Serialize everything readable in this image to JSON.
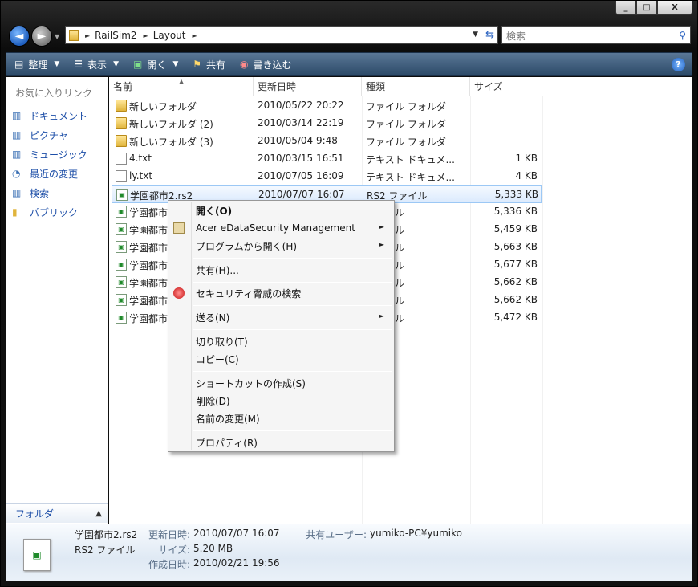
{
  "window": {
    "min": "_",
    "max": "□",
    "close": "X"
  },
  "address": {
    "segments": [
      "RailSim2",
      "Layout"
    ]
  },
  "search": {
    "placeholder": "検索"
  },
  "toolbar": {
    "organize": "整理",
    "view": "表示",
    "open": "開く",
    "share": "共有",
    "burn": "書き込む"
  },
  "left_pane": {
    "heading": "お気に入りリンク",
    "items": [
      "ドキュメント",
      "ピクチャ",
      "ミュージック",
      "最近の変更",
      "検索",
      "パブリック"
    ],
    "folders": "フォルダ"
  },
  "columns": {
    "name": "名前",
    "date": "更新日時",
    "type": "種類",
    "size": "サイズ"
  },
  "files": [
    {
      "name": "新しいフォルダ",
      "date": "2010/05/22 20:22",
      "type": "ファイル フォルダ",
      "size": "",
      "kind": "folder"
    },
    {
      "name": "新しいフォルダ (2)",
      "date": "2010/03/14 22:19",
      "type": "ファイル フォルダ",
      "size": "",
      "kind": "folder"
    },
    {
      "name": "新しいフォルダ (3)",
      "date": "2010/05/04 9:48",
      "type": "ファイル フォルダ",
      "size": "",
      "kind": "folder"
    },
    {
      "name": "4.txt",
      "date": "2010/03/15 16:51",
      "type": "テキスト ドキュメ...",
      "size": "1 KB",
      "kind": "txt"
    },
    {
      "name": "ly.txt",
      "date": "2010/07/05 16:09",
      "type": "テキスト ドキュメ...",
      "size": "4 KB",
      "kind": "txt"
    },
    {
      "name": "学園都市2.rs2",
      "date": "2010/07/07 16:07",
      "type": "RS2 ファイル",
      "size": "5,333 KB",
      "kind": "rs2"
    },
    {
      "name": "学園都市",
      "date": "",
      "type": "ファイル",
      "size": "5,336 KB",
      "kind": "rs2"
    },
    {
      "name": "学園都市",
      "date": "",
      "type": "ファイル",
      "size": "5,459 KB",
      "kind": "rs2"
    },
    {
      "name": "学園都市",
      "date": "",
      "type": "ファイル",
      "size": "5,663 KB",
      "kind": "rs2"
    },
    {
      "name": "学園都市",
      "date": "",
      "type": "ファイル",
      "size": "5,677 KB",
      "kind": "rs2"
    },
    {
      "name": "学園都市",
      "date": "",
      "type": "ファイル",
      "size": "5,662 KB",
      "kind": "rs2"
    },
    {
      "name": "学園都市",
      "date": "",
      "type": "ファイル",
      "size": "5,662 KB",
      "kind": "rs2"
    },
    {
      "name": "学園都市",
      "date": "",
      "type": "ファイル",
      "size": "5,472 KB",
      "kind": "rs2"
    }
  ],
  "context_menu": {
    "open": "開く(O)",
    "acer": "Acer eDataSecurity Management",
    "open_with": "プログラムから開く(H)",
    "share": "共有(H)...",
    "scan": "セキュリティ脅威の検索",
    "send_to": "送る(N)",
    "cut": "切り取り(T)",
    "copy": "コピー(C)",
    "shortcut": "ショートカットの作成(S)",
    "delete": "削除(D)",
    "rename": "名前の変更(M)",
    "properties": "プロパティ(R)"
  },
  "details": {
    "filename": "学園都市2.rs2",
    "filetype": "RS2 ファイル",
    "modified_label": "更新日時:",
    "modified": "2010/07/07 16:07",
    "size_label": "サイズ:",
    "size": "5.20 MB",
    "created_label": "作成日時:",
    "created": "2010/02/21 19:56",
    "shared_label": "共有ユーザー:",
    "shared": "yumiko-PC¥yumiko"
  }
}
